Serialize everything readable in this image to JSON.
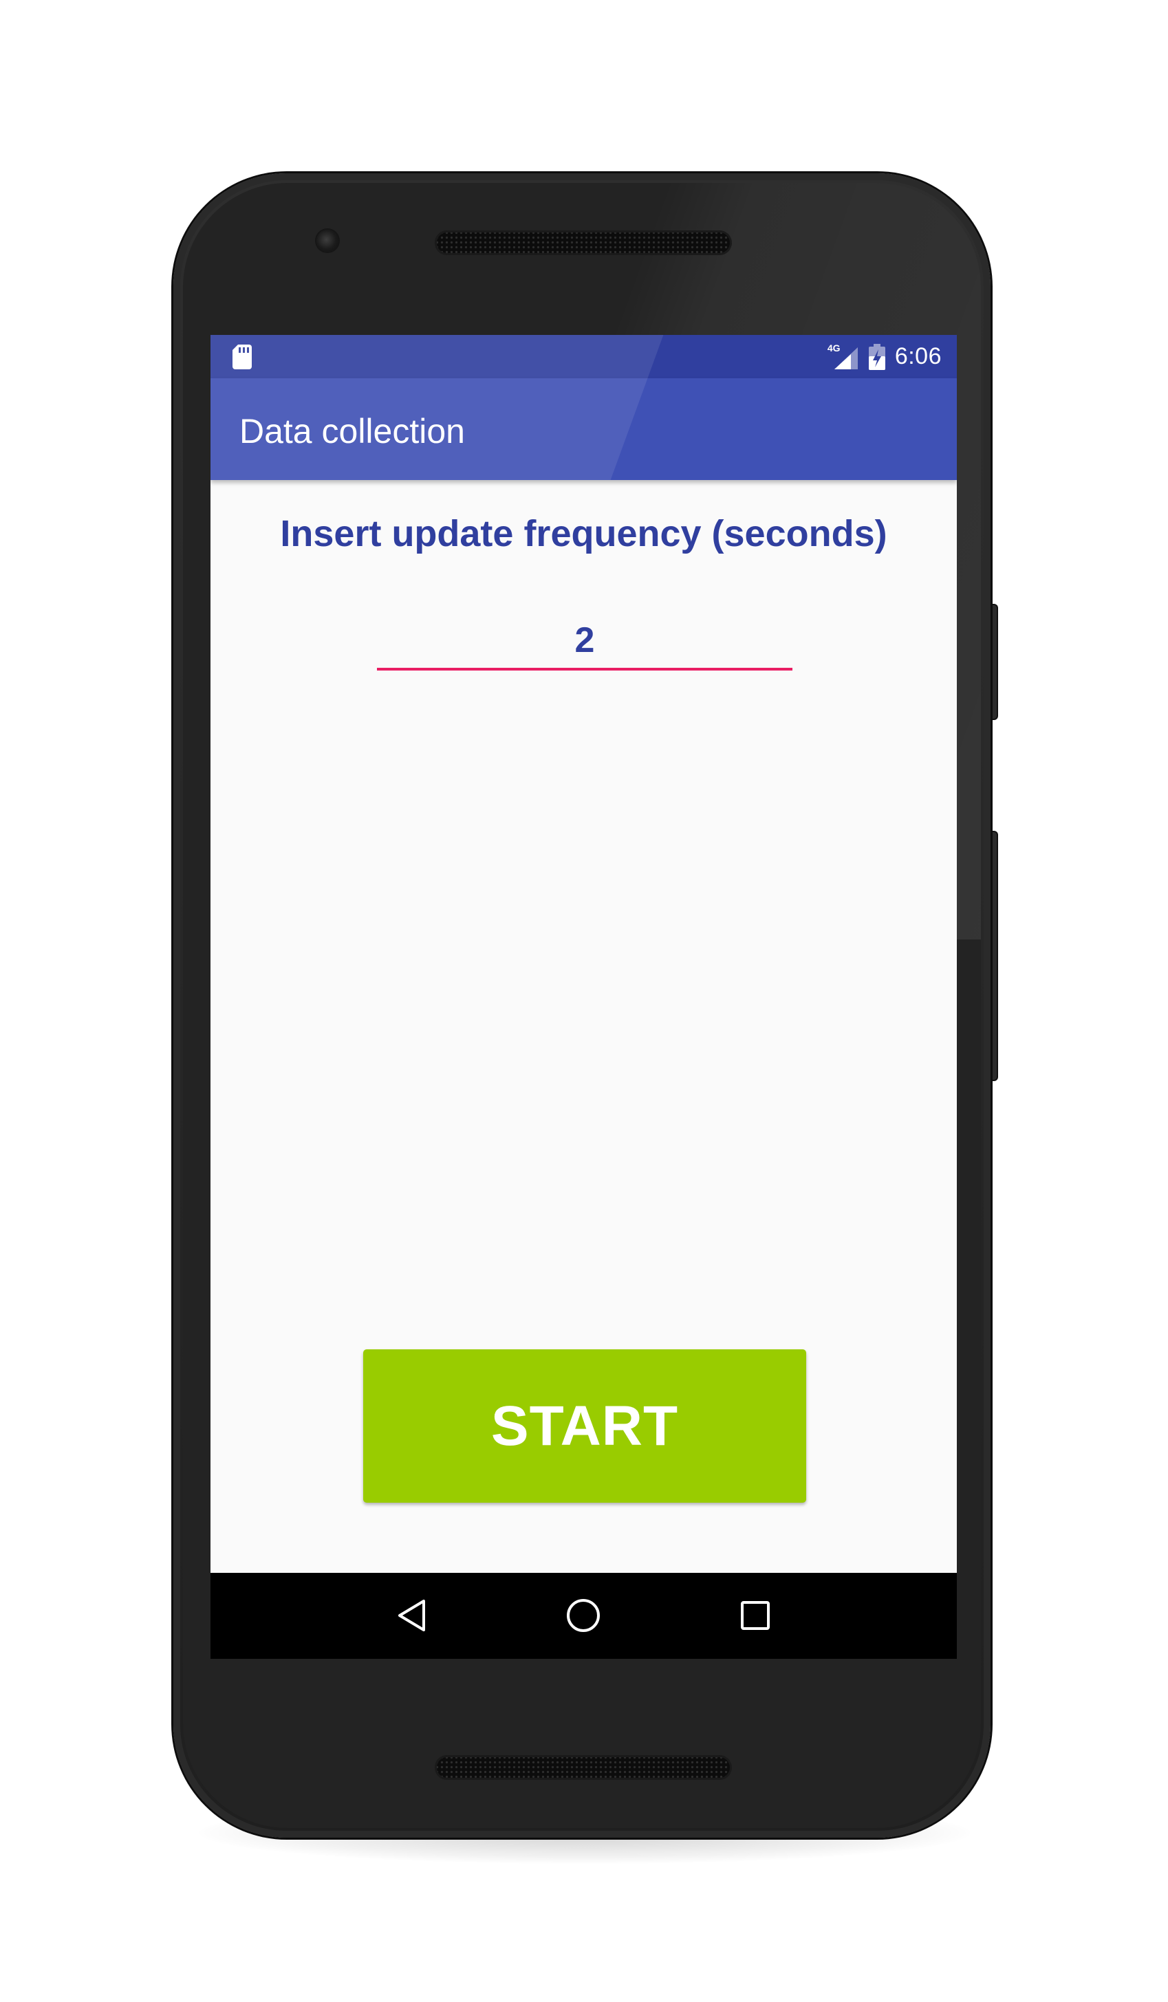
{
  "status_bar": {
    "network": "4G",
    "time": "6:06",
    "icons": [
      "sd-card-icon",
      "signal-icon",
      "battery-charging-icon"
    ]
  },
  "app_bar": {
    "title": "Data collection"
  },
  "main": {
    "prompt": "Insert update frequency (seconds)",
    "frequency_value": "2",
    "start_label": "START"
  },
  "nav_bar": {
    "icons": [
      "back-icon",
      "home-icon",
      "recents-icon"
    ]
  },
  "colors": {
    "status_bar": "#303f9f",
    "app_bar": "#3f51b5",
    "accent": "#e91e63",
    "button": "#99cc00",
    "text_primary": "#303f9f"
  }
}
